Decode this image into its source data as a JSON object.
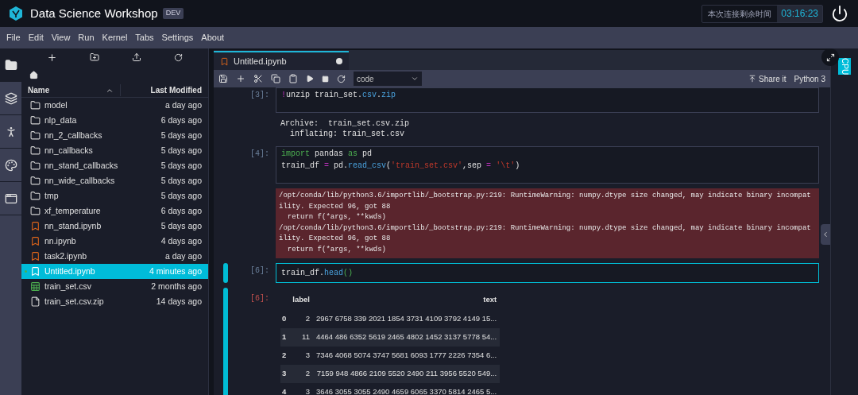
{
  "app": {
    "title": "Data Science Workshop",
    "badge": "DEV",
    "timer_label": "本次连接剩余时间",
    "timer_value": "03:16:23"
  },
  "menu": [
    "File",
    "Edit",
    "View",
    "Run",
    "Kernel",
    "Tabs",
    "Settings",
    "About"
  ],
  "rail": [
    {
      "kind": "folder",
      "selected": true
    },
    {
      "kind": "tabs",
      "selected": false
    },
    {
      "kind": "runner",
      "selected": false
    },
    {
      "kind": "palette",
      "selected": false
    },
    {
      "kind": "window",
      "selected": false
    }
  ],
  "file_browser": {
    "columns": [
      "Name",
      "Last Modified"
    ],
    "files": [
      {
        "name": "model",
        "modified": "a day ago",
        "kind": "folder",
        "selected": false,
        "running": false
      },
      {
        "name": "nlp_data",
        "modified": "6 days ago",
        "kind": "folder",
        "selected": false,
        "running": false
      },
      {
        "name": "nn_2_callbacks",
        "modified": "5 days ago",
        "kind": "folder",
        "selected": false,
        "running": false
      },
      {
        "name": "nn_callbacks",
        "modified": "5 days ago",
        "kind": "folder",
        "selected": false,
        "running": false
      },
      {
        "name": "nn_stand_callbacks",
        "modified": "5 days ago",
        "kind": "folder",
        "selected": false,
        "running": false
      },
      {
        "name": "nn_wide_callbacks",
        "modified": "5 days ago",
        "kind": "folder",
        "selected": false,
        "running": false
      },
      {
        "name": "tmp",
        "modified": "5 days ago",
        "kind": "folder",
        "selected": false,
        "running": false
      },
      {
        "name": "xf_temperature",
        "modified": "6 days ago",
        "kind": "folder",
        "selected": false,
        "running": false
      },
      {
        "name": "nn_stand.ipynb",
        "modified": "5 days ago",
        "kind": "notebook",
        "selected": false,
        "running": false
      },
      {
        "name": "nn.ipynb",
        "modified": "4 days ago",
        "kind": "notebook",
        "selected": false,
        "running": false
      },
      {
        "name": "task2.ipynb",
        "modified": "a day ago",
        "kind": "notebook",
        "selected": false,
        "running": false
      },
      {
        "name": "Untitled.ipynb",
        "modified": "4 minutes ago",
        "kind": "notebook",
        "selected": true,
        "running": true
      },
      {
        "name": "train_set.csv",
        "modified": "2 months ago",
        "kind": "csv",
        "selected": false,
        "running": false
      },
      {
        "name": "train_set.csv.zip",
        "modified": "14 days ago",
        "kind": "file",
        "selected": false,
        "running": false
      }
    ]
  },
  "notebook": {
    "tab": {
      "title": "Untitled.ipynb",
      "unsaved": true
    },
    "cell_type": "code",
    "share": "Share it",
    "kernel": "Python 3",
    "cells": [
      {
        "kind": "code",
        "prompt": "[3]:",
        "selected": false,
        "lines": [
          [
            {
              "t": "!",
              "kind": "bang"
            },
            {
              "t": "unzip train_set.",
              "kind": "plain"
            },
            {
              "t": "csv",
              "kind": "func"
            },
            {
              "t": ".",
              "kind": "plain"
            },
            {
              "t": "zip",
              "kind": "func"
            }
          ]
        ]
      },
      {
        "kind": "stdout",
        "lines": [
          "Archive:  train_set.csv.zip",
          "  inflating: train_set.csv"
        ]
      },
      {
        "kind": "code",
        "prompt": "[4]:",
        "selected": false,
        "lines": [
          [
            {
              "t": "import",
              "kind": "keyword"
            },
            {
              "t": " pandas ",
              "kind": "plain"
            },
            {
              "t": "as",
              "kind": "keyword"
            },
            {
              "t": " pd",
              "kind": "plain"
            }
          ],
          [
            {
              "t": "train_df ",
              "kind": "plain"
            },
            {
              "t": "=",
              "kind": "op"
            },
            {
              "t": " pd.",
              "kind": "plain"
            },
            {
              "t": "read_csv",
              "kind": "func"
            },
            {
              "t": "(",
              "kind": "plain"
            },
            {
              "t": "'train_set.csv'",
              "kind": "string"
            },
            {
              "t": ",sep ",
              "kind": "plain"
            },
            {
              "t": "= ",
              "kind": "op"
            },
            {
              "t": "'\\t'",
              "kind": "string"
            },
            {
              "t": ")",
              "kind": "plain"
            }
          ]
        ]
      },
      {
        "kind": "stderr",
        "lines": [
          "/opt/conda/lib/python3.6/importlib/_bootstrap.py:219: RuntimeWarning: numpy.dtype size changed, may indicate binary incompat",
          "ility. Expected 96, got 88",
          "  return f(*args, **kwds)",
          "/opt/conda/lib/python3.6/importlib/_bootstrap.py:219: RuntimeWarning: numpy.dtype size changed, may indicate binary incompat",
          "ility. Expected 96, got 88",
          "  return f(*args, **kwds)"
        ]
      },
      {
        "kind": "code",
        "prompt": "[6]:",
        "selected": true,
        "lines": [
          [
            {
              "t": "train_df.",
              "kind": "plain"
            },
            {
              "t": "head",
              "kind": "func"
            },
            {
              "t": "()",
              "kind": "paren"
            }
          ]
        ]
      },
      {
        "kind": "table",
        "prompt": "[6]:",
        "selected": true,
        "columns": [
          "",
          "label",
          "text"
        ],
        "rows": [
          [
            "0",
            "2",
            "2967 6758 339 2021 1854 3731 4109 3792 4149 15..."
          ],
          [
            "1",
            "11",
            "4464 486 6352 5619 2465 4802 1452 3137 5778 54..."
          ],
          [
            "2",
            "3",
            "7346 4068 5074 3747 5681 6093 1777 2226 7354 6..."
          ],
          [
            "3",
            "2",
            "7159 948 4866 2109 5520 2490 211 3956 5520 549..."
          ],
          [
            "4",
            "3",
            "3646 3055 3055 2490 4659 6065 3370 5814 2465 5..."
          ]
        ]
      }
    ]
  },
  "right_panel": {
    "tab": "CPU"
  }
}
